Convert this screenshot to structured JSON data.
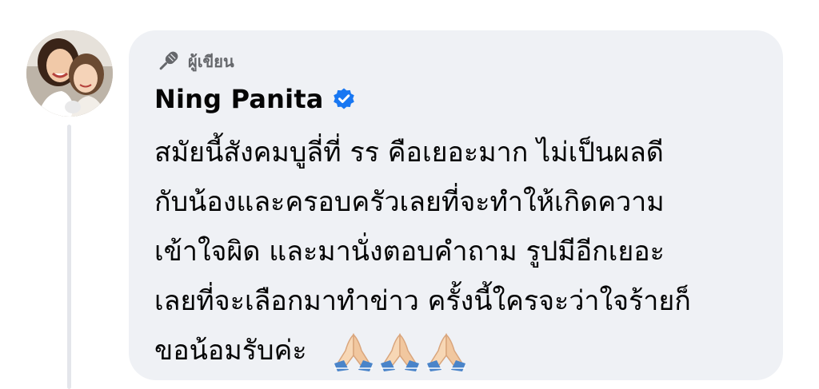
{
  "comment": {
    "author_badge": "ผู้เขียน",
    "author_name": "Ning Panita",
    "verified": true,
    "lines": [
      "สมัยนี้สังคมบูลี่ที่ รร คือเยอะมาก ไม่เป็นผลดี",
      "กับน้องและครอบครัวเลยที่จะทำให้เกิดความ",
      "เข้าใจผิด และมานั่งตอบคำถาม รูปมีอีกเยอะ",
      "เลยที่จะเลือกมาทำข่าว ครั้งนี้ใครจะว่าใจร้ายก็",
      "ขอน้อมรับค่ะ"
    ],
    "emojis": [
      "folded-hands",
      "folded-hands",
      "folded-hands"
    ]
  },
  "icons": {
    "author_badge": "microphone-icon",
    "verified": "verified-check-icon",
    "emoji": "folded-hands-icon"
  },
  "colors": {
    "bubble_bg": "#eff1f5",
    "verified_blue": "#1877f2",
    "text_primary": "#050505",
    "text_secondary": "#65676b"
  }
}
